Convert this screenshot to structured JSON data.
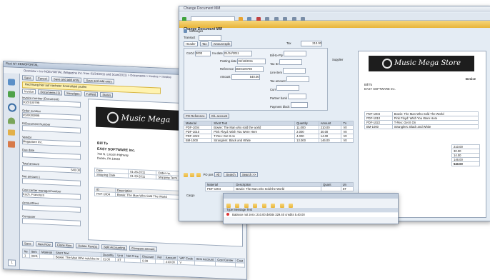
{
  "left_window": {
    "title": "Flexi NT DEMOPORTAL",
    "breadcrumb": "Overview > Inv NOEVORTAL (Magazine Inc. from 01/24/2011 and Scan/2011) > Documents > Invoice > Invoice",
    "toolbar_buttons": [
      "Save",
      "Cancel",
      "Save and add entry",
      "Save and add entry"
    ],
    "notice": "Rechnung hier auf nachster Kontrollstel prufen",
    "tabs": [
      "Invoice",
      "Documents (1)",
      "Sonstiges",
      "Fullfeld",
      "Status"
    ],
    "form": {
      "invoice_number_label": "Invoice number (Document)",
      "invoice_number_value": "3020100798",
      "order_number_label": "Order number",
      "order_number_value": "4500003888",
      "rfq_label": "R/Document Number",
      "vendor_label": "Vendor",
      "vendor_value": "Megastore Inc.",
      "due_date_label": "Due date",
      "total_label": "Total amount",
      "total_value": "540.00",
      "net_amount_label": "Net amount 1",
      "cost_center_label": "Cost center manager/number",
      "cost_center_value": "Koch, Francisco",
      "account_label": "Account/text",
      "computer_label": "Computer"
    },
    "bottom_buttons": [
      "Save",
      "New Row",
      "Clone Row",
      "Delete Row(s)",
      "Split Accounting",
      "Compare amount"
    ],
    "table_headers": [
      "Ite",
      "Item",
      "Material",
      "Short Text",
      "Quantity",
      "Unit",
      "Net Price",
      "Discount",
      "Per",
      "Amount",
      "VAT Code",
      "Item Account",
      "Cost Center",
      "Cost"
    ],
    "table_row": [
      "1",
      "0001",
      "",
      "Bowie: The Man Who sold the W",
      "11.00",
      "ST",
      "",
      "0.00",
      "",
      "210.00",
      "V",
      "",
      "",
      ""
    ],
    "page_indicator": "1"
  },
  "right_window": {
    "title_bar": "Change Document MM",
    "title": "Change Document MM",
    "messages_label": "Messages",
    "transaction_label": "Transact",
    "tabs": [
      "Header",
      "Tax",
      "Amount split"
    ],
    "tax_label": "Tax",
    "fields": [
      {
        "label": "CoCd",
        "value": "3000"
      },
      {
        "label": "Inv.date",
        "value": "01/24/2011"
      },
      {
        "label": "Posting date",
        "value": "02/18/2011"
      },
      {
        "label": "Reference",
        "value": "3020100798"
      },
      {
        "label": "Amount",
        "value": "540.00"
      }
    ],
    "right_fields": [
      "Bill-to-Pty",
      "Tax ID",
      "Line item",
      "Tax amount",
      "Curr",
      "Partner bank",
      "Payment block"
    ],
    "amount_value": "210.00",
    "supplier_label": "Supplier",
    "po_ref_tabs": [
      "PO Reference",
      "G/L account"
    ],
    "po_headers": [
      "Material",
      "Short Text",
      "Quantity",
      "Amount",
      "Tx",
      "Pro"
    ],
    "po_rows": [
      [
        "PDF-1004",
        "Bowie: The Man who sold the world",
        "11.000",
        "210.00",
        "V0"
      ],
      [
        "PDF-1010",
        "Pink Floyd: Wish You Were Here",
        "2.000",
        "30.00",
        "V0"
      ],
      [
        "PDF-1022",
        "T-Rex: Get It on",
        "4.000",
        "14.00",
        "V0"
      ],
      [
        "BM-1000",
        "Stranglers: Black and White",
        "13.000",
        "146.00",
        "V0"
      ]
    ],
    "pos_label": "PO pos",
    "search_buttons": [
      "All",
      "Search",
      "Search >>"
    ],
    "bottom_headers": [
      "Material",
      "Description",
      "Quant",
      "Un"
    ],
    "bottom_row": [
      "PDF-1004",
      "Bowie: The Man who Sold the World",
      "",
      "ST"
    ],
    "cargo_label": "Cargo",
    "message_title": "Type  Message Text",
    "message_text": "Balance not zero: 210.00 debits 329.40 credits 5.40.00"
  },
  "invoice_doc": {
    "logo_text": "Music Mega Store",
    "heading": "Invoice",
    "bill_to": "Bill To",
    "company": "EASY SOFTWARE Inc.",
    "address1": "750 N. Lincoln Highway",
    "address2": "Dublin, PA 18940",
    "date_label": "Date",
    "date_value": "01-26-2011",
    "order_label": "Order no.",
    "shipping_date_label": "Shipping Date",
    "shipping_date_value": "01-29-2011",
    "shipping_term_label": "Shipping Term",
    "item_headers": [
      "ID",
      "Description",
      "Unit",
      "Unit Price",
      "Qty",
      "Total ($)"
    ],
    "item_row": [
      "PDF-1004",
      "Bowie: The Man Who Sold The World",
      "ST",
      "",
      "",
      ""
    ],
    "right_items": [
      [
        "PDF-1004",
        "Bowie: The Man Who Sold The World"
      ],
      [
        "PDF-1010",
        "Pink Floyd: Wish You Were Here"
      ],
      [
        "PDF-1022",
        "T-Rex: Get It On"
      ],
      [
        "BM-1000",
        "Stranglers: Black and White"
      ]
    ],
    "totals": [
      "210.00",
      "30.00",
      "14.00",
      "146.00",
      "540.00"
    ]
  },
  "colors": {
    "gold": "#e8b53a",
    "frame": "#8a9ab0",
    "header": "#b5c4d8",
    "logo_bg": "#1d1d1d"
  }
}
